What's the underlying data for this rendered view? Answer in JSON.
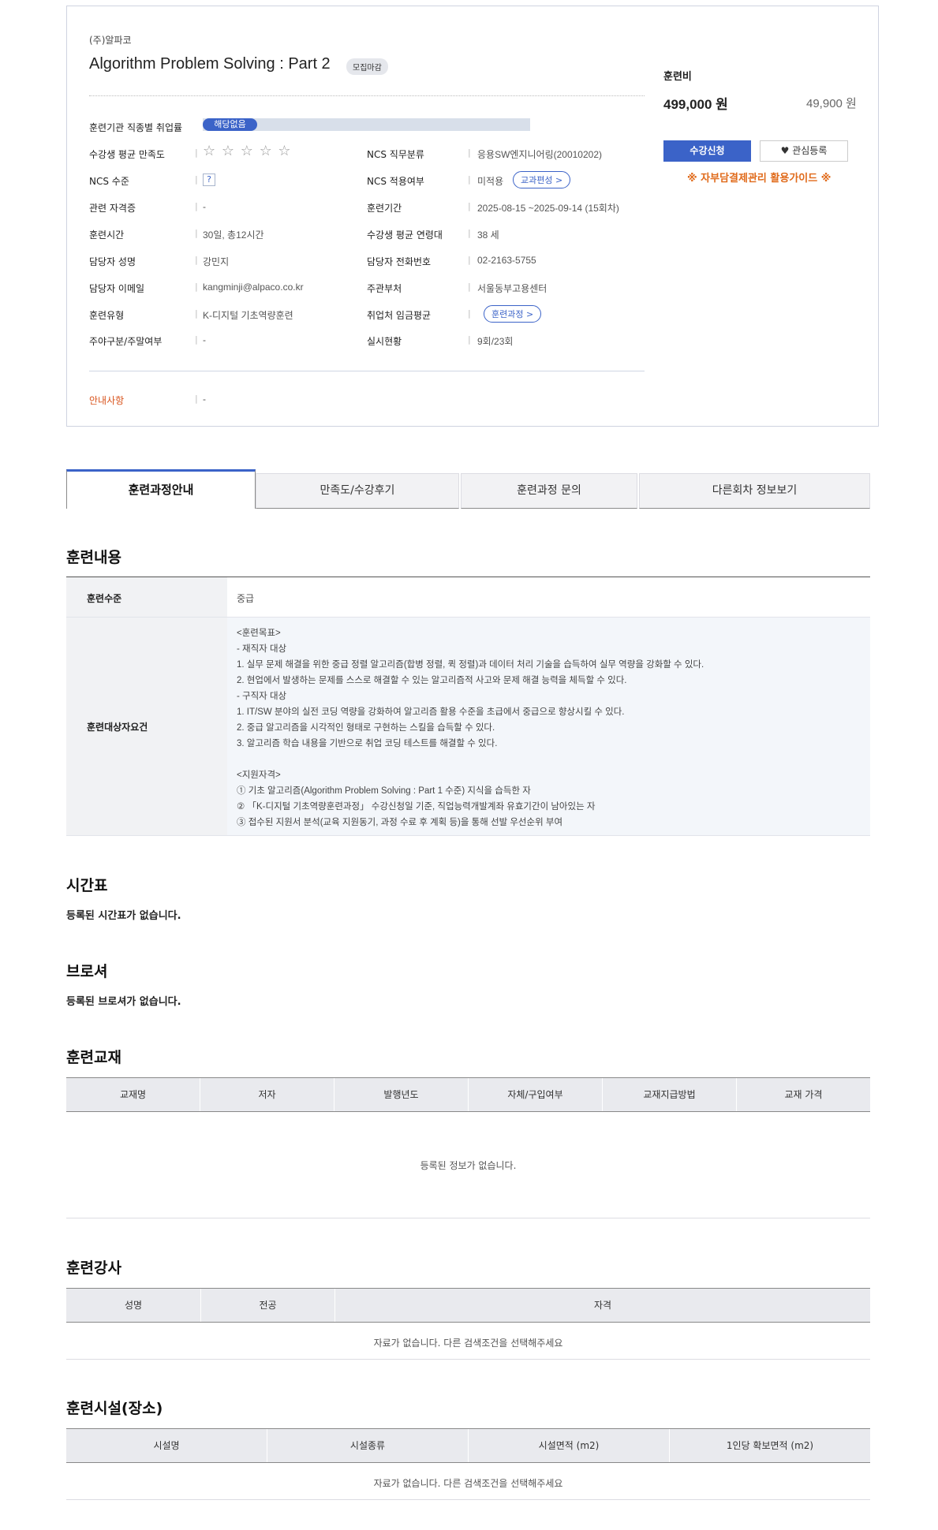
{
  "course": {
    "org": "(주)알파코",
    "title": "Algorithm Problem Solving : Part 2",
    "status_badge": "모집마감",
    "employment_label": "훈련기관 직종별 취업률",
    "employment_value": "해당없음",
    "rows": [
      {
        "l1": "수강생 평균 만족도",
        "v1": "☆ ☆ ☆ ☆ ☆",
        "l2": "NCS 직무분류",
        "v2": "응용SW엔지니어링(20010202)"
      },
      {
        "l1": "NCS 수준",
        "v1": "?",
        "l2": "NCS 적용여부",
        "v2": "미적용",
        "pill2": "교과편성 >"
      },
      {
        "l1": "관련 자격증",
        "v1": "-",
        "l2": "훈련기간",
        "v2": "2025-08-15 ~2025-09-14 (15회차)"
      },
      {
        "l1": "훈련시간",
        "v1": "30일, 총12시간",
        "l2": "수강생 평균 연령대",
        "v2": "38 세"
      },
      {
        "l1": "담당자 성명",
        "v1": "강민지",
        "l2": "담당자 전화번호",
        "v2": "02-2163-5755"
      },
      {
        "l1": "담당자 이메일",
        "v1": "kangminji@alpaco.co.kr",
        "l2": "주관부처",
        "v2": "서울동부고용센터"
      },
      {
        "l1": "훈련유형",
        "v1": "K-디지털 기초역량훈련",
        "l2": "취업처 임금평균",
        "v2": "",
        "pill2": "훈련과정 >"
      },
      {
        "l1": "주야구분/주말여부",
        "v1": "-",
        "l2": "실시현황",
        "v2": "9회/23회"
      }
    ],
    "notice_label": "안내사항",
    "notice_value": "-",
    "fee_label": "훈련비",
    "fee_main": "499,000 원",
    "fee_sub": "49,900 원",
    "apply_button": "수강신청",
    "like_button": "관심등록",
    "guide_text": "※ 자부담결제관리 활용가이드 ※"
  },
  "tabs": [
    "훈련과정안내",
    "만족도/수강후기",
    "훈련과정 문의",
    "다른회차 정보보기"
  ],
  "training_content": {
    "title": "훈련내용",
    "level_label": "훈련수준",
    "level_value": "중급",
    "target_label": "훈련대상자요건",
    "lines": [
      "<훈련목표>",
      "- 재직자 대상",
      "1. 실무 문제 해결을 위한 중급 정렬 알고리즘(합병 정렬, 퀵 정렬)과 데이터 처리 기술을 습득하여 실무 역량을 강화할 수 있다.",
      "2. 현업에서 발생하는 문제를 스스로 해결할 수 있는 알고리즘적 사고와 문제 해결 능력을 체득할 수 있다.",
      "- 구직자 대상",
      "1. IT/SW 분야의 실전 코딩 역량을 강화하여 알고리즘 활용 수준을 초급에서 중급으로 향상시킬 수 있다.",
      "2. 중급 알고리즘을 시각적인 형태로 구현하는 스킬을 습득할 수 있다.",
      "3. 알고리즘 학습 내용을 기반으로 취업 코딩 테스트를 해결할 수 있다.",
      "",
      "<지원자격>",
      "① 기초 알고리즘(Algorithm Problem Solving : Part 1 수준) 지식을 습득한 자",
      "② 「K-디지털 기초역량훈련과정」 수강신청일 기준, 직업능력개발계좌 유효기간이 남아있는 자",
      "③ 접수된 지원서 분석(교육 지원동기, 과정 수료 후 계획 등)을 통해 선발 우선순위 부여"
    ]
  },
  "schedule": {
    "title": "시간표",
    "message": "등록된 시간표가 없습니다."
  },
  "brochure": {
    "title": "브로셔",
    "message": "등록된 브로셔가 없습니다."
  },
  "textbook": {
    "title": "훈련교재",
    "headers": [
      "교재명",
      "저자",
      "발행년도",
      "자체/구입여부",
      "교재지급방법",
      "교재 가격"
    ],
    "empty": "등록된 정보가 없습니다."
  },
  "instructor": {
    "title": "훈련강사",
    "headers": [
      "성명",
      "전공",
      "자격"
    ],
    "empty": "자료가 없습니다. 다른 검색조건을 선택해주세요"
  },
  "facility": {
    "title": "훈련시설(장소)",
    "headers": [
      "시설명",
      "시설종류",
      "시설면적 (m2)",
      "1인당 확보면적 (m2)"
    ],
    "empty": "자료가 없습니다. 다른 검색조건을 선택해주세요"
  }
}
